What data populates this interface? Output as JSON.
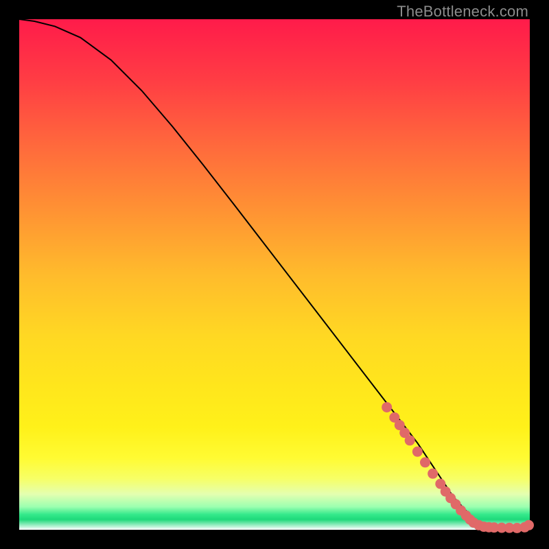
{
  "watermark": "TheBottleneck.com",
  "colors": {
    "dot": "#e06968",
    "curve": "#000000"
  },
  "chart_data": {
    "type": "line",
    "title": "",
    "xlabel": "",
    "ylabel": "",
    "xlim": [
      0,
      100
    ],
    "ylim": [
      0,
      100
    ],
    "grid": false,
    "legend": false,
    "series": [
      {
        "name": "bottleneck-curve",
        "x": [
          0,
          3,
          7,
          12,
          18,
          24,
          30,
          36,
          42,
          48,
          54,
          60,
          66,
          72,
          78,
          82,
          85,
          88,
          90,
          92,
          94,
          96,
          98,
          100
        ],
        "y": [
          100,
          99.6,
          98.6,
          96.4,
          92.0,
          86.0,
          79.0,
          71.5,
          63.8,
          56.0,
          48.2,
          40.4,
          32.6,
          24.8,
          17.0,
          11.0,
          6.5,
          3.2,
          1.6,
          0.8,
          0.5,
          0.4,
          0.35,
          0.3
        ]
      }
    ],
    "points": [
      {
        "name": "p1",
        "x": 72.0,
        "y": 24.0
      },
      {
        "name": "p2",
        "x": 73.5,
        "y": 22.0
      },
      {
        "name": "p3",
        "x": 74.5,
        "y": 20.5
      },
      {
        "name": "p4",
        "x": 75.5,
        "y": 19.0
      },
      {
        "name": "p5",
        "x": 76.5,
        "y": 17.5
      },
      {
        "name": "p6",
        "x": 78.0,
        "y": 15.3
      },
      {
        "name": "p7",
        "x": 79.5,
        "y": 13.2
      },
      {
        "name": "p8",
        "x": 81.0,
        "y": 11.0
      },
      {
        "name": "p9",
        "x": 82.5,
        "y": 9.0
      },
      {
        "name": "p10",
        "x": 83.5,
        "y": 7.5
      },
      {
        "name": "p11",
        "x": 84.5,
        "y": 6.2
      },
      {
        "name": "p12",
        "x": 85.5,
        "y": 5.0
      },
      {
        "name": "p13",
        "x": 86.5,
        "y": 3.8
      },
      {
        "name": "p14",
        "x": 87.5,
        "y": 2.8
      },
      {
        "name": "p15",
        "x": 88.3,
        "y": 2.0
      },
      {
        "name": "p16",
        "x": 89.0,
        "y": 1.4
      },
      {
        "name": "p17",
        "x": 90.0,
        "y": 0.9
      },
      {
        "name": "p18",
        "x": 91.0,
        "y": 0.6
      },
      {
        "name": "p19",
        "x": 92.0,
        "y": 0.5
      },
      {
        "name": "p20",
        "x": 93.0,
        "y": 0.45
      },
      {
        "name": "p21",
        "x": 94.5,
        "y": 0.4
      },
      {
        "name": "p22",
        "x": 96.0,
        "y": 0.38
      },
      {
        "name": "p23",
        "x": 97.5,
        "y": 0.35
      },
      {
        "name": "p24",
        "x": 99.0,
        "y": 0.5
      },
      {
        "name": "p25",
        "x": 99.8,
        "y": 0.9
      }
    ]
  }
}
